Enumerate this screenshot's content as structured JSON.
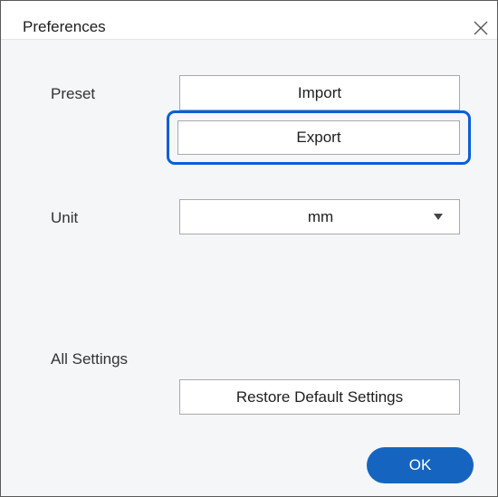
{
  "window": {
    "title": "Preferences"
  },
  "preset": {
    "label": "Preset",
    "import_label": "Import",
    "export_label": "Export"
  },
  "unit": {
    "label": "Unit",
    "selected": "mm"
  },
  "all_settings": {
    "label": "All Settings",
    "restore_label": "Restore Default Settings"
  },
  "footer": {
    "ok_label": "OK"
  },
  "icons": {
    "close": "close-icon",
    "dropdown": "chevron-down-icon"
  },
  "colors": {
    "accent": "#1565c0",
    "focus_ring": "#0a5fd6",
    "background": "#f5f6f8"
  }
}
